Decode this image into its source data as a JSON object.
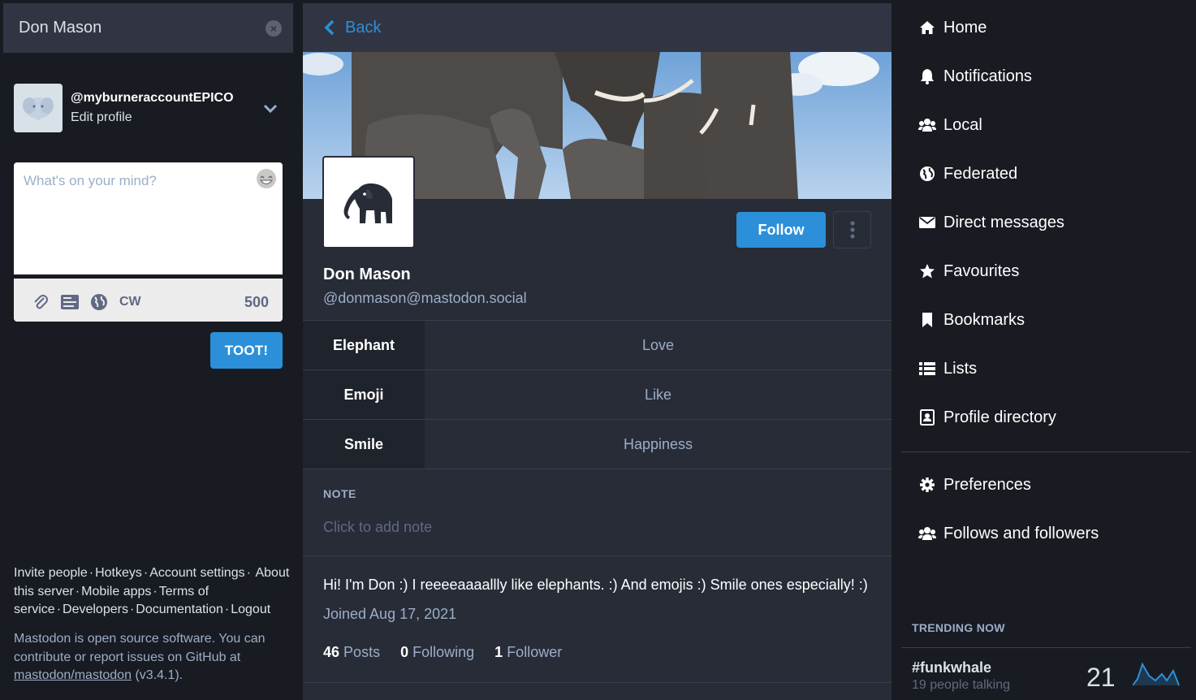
{
  "search": {
    "value": "Don Mason"
  },
  "account": {
    "handle": "@myburneraccountEPICO",
    "edit_label": "Edit profile"
  },
  "compose": {
    "placeholder": "What's on your mind?",
    "cw_label": "CW",
    "char_count": "500",
    "toot_label": "TOOT!"
  },
  "footer_links": {
    "invite": "Invite people",
    "hotkeys": "Hotkeys",
    "account_settings": "Account settings",
    "about": "About this server",
    "mobile": "Mobile apps",
    "terms": "Terms of service",
    "developers": "Developers",
    "documentation": "Documentation",
    "logout": "Logout"
  },
  "about": {
    "text": "Mastodon is open source software. You can contribute or report issues on GitHub at",
    "repo": "mastodon/mastodon",
    "version": "(v3.4.1)."
  },
  "header": {
    "back_label": "Back"
  },
  "profile": {
    "name": "Don Mason",
    "acct": "@donmason@mastodon.social",
    "follow_label": "Follow",
    "fields": [
      {
        "name": "Elephant",
        "value": "Love"
      },
      {
        "name": "Emoji",
        "value": "Like"
      },
      {
        "name": "Smile",
        "value": "Happiness"
      }
    ],
    "note_label": "NOTE",
    "note_placeholder": "Click to add note",
    "bio": "Hi! I'm Don :) I reeeeaaaallly like elephants. :) And emojis :) Smile ones especially! :)",
    "joined": "Joined Aug 17, 2021",
    "posts_count": "46",
    "posts_label": "Posts",
    "following_count": "0",
    "following_label": "Following",
    "followers_count": "1",
    "followers_label": "Follower"
  },
  "nav": {
    "items": [
      {
        "label": "Home",
        "icon": "home-icon"
      },
      {
        "label": "Notifications",
        "icon": "bell-icon"
      },
      {
        "label": "Local",
        "icon": "users-icon"
      },
      {
        "label": "Federated",
        "icon": "globe-icon"
      },
      {
        "label": "Direct messages",
        "icon": "envelope-icon"
      },
      {
        "label": "Favourites",
        "icon": "star-icon"
      },
      {
        "label": "Bookmarks",
        "icon": "bookmark-icon"
      },
      {
        "label": "Lists",
        "icon": "list-icon"
      },
      {
        "label": "Profile directory",
        "icon": "address-book-icon"
      }
    ],
    "secondary": [
      {
        "label": "Preferences",
        "icon": "gear-icon"
      },
      {
        "label": "Follows and followers",
        "icon": "users-icon"
      }
    ]
  },
  "trending": {
    "label": "TRENDING NOW",
    "tag": "#funkwhale",
    "people": "19 people talking",
    "count": "21"
  },
  "colors": {
    "accent": "#2b90d9",
    "background": "#191b22",
    "panel": "#282c37"
  }
}
